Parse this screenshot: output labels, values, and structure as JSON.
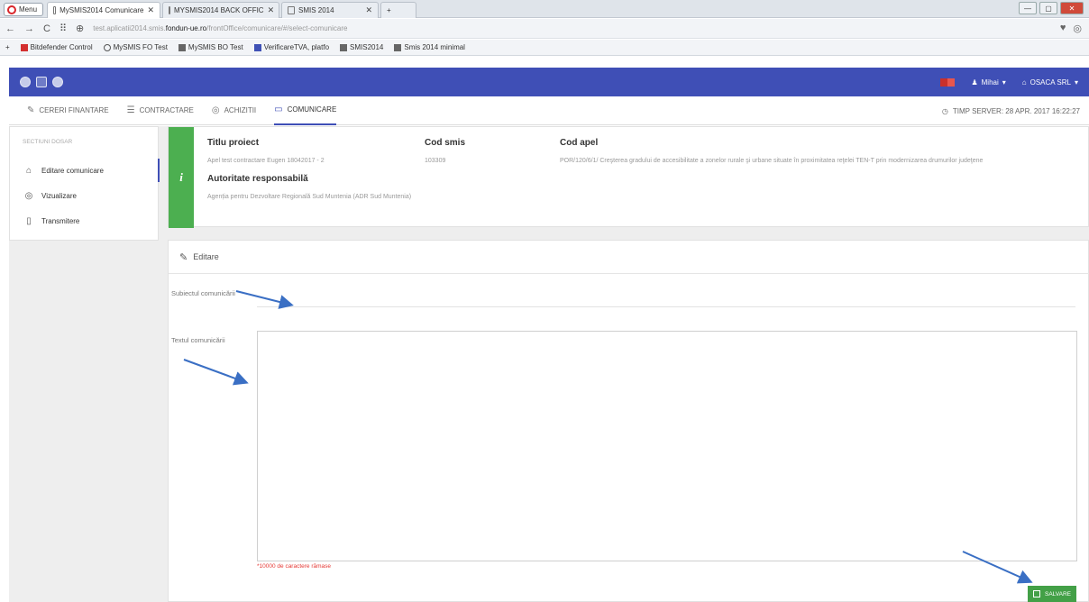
{
  "browser": {
    "menu_label": "Menu",
    "tabs": [
      {
        "label": "MySMIS2014 Comunicare"
      },
      {
        "label": "MYSMIS2014 BACK OFFIC"
      },
      {
        "label": "SMIS 2014"
      }
    ],
    "url_prefix": "test.aplicatii2014.smis.",
    "url_domain": "fondun-ue.ro",
    "url_suffix": "/frontOffice/comunicare/#/select-comunicare",
    "bookmarks": [
      {
        "label": "Bitdefender Control"
      },
      {
        "label": "MySMIS FO Test"
      },
      {
        "label": "MySMIS BO Test"
      },
      {
        "label": "VerificareTVA, platfo"
      },
      {
        "label": "SMIS2014"
      },
      {
        "label": "Smis 2014 minimal"
      }
    ]
  },
  "app": {
    "user": "Mihai",
    "organization": "OSACA SRL",
    "nav": [
      {
        "label": "CERERI FINANTARE",
        "icon": "pencil-icon"
      },
      {
        "label": "CONTRACTARE",
        "icon": "document-icon"
      },
      {
        "label": "ACHIZITII",
        "icon": "stack-icon"
      },
      {
        "label": "COMUNICARE",
        "icon": "chat-icon"
      }
    ],
    "server_time": "TIMP SERVER: 28 APR. 2017 16:22:27"
  },
  "sidebar": {
    "title": "SECTIUNI DOSAR",
    "items": [
      {
        "label": "Editare comunicare",
        "icon": "home-icon"
      },
      {
        "label": "Vizualizare",
        "icon": "stack-icon"
      },
      {
        "label": "Transmitere",
        "icon": "send-icon"
      }
    ]
  },
  "project": {
    "titlu_label": "Titlu proiect",
    "titlu_value": "Apel test contractare Eugen 18042017 - 2",
    "smis_label": "Cod smis",
    "smis_value": "103309",
    "apel_label": "Cod apel",
    "apel_value": "POR/120/6/1/ Creşterea gradului de accesibilitate a zonelor rurale şi urbane situate în proximitatea reţelei TEN-T prin modernizarea drumurilor judeţene",
    "autoritate_label": "Autoritate responsabilă",
    "autoritate_value": "Agenția pentru Dezvoltare Regională Sud Muntenia (ADR Sud Muntenia)"
  },
  "edit": {
    "header": "Editare",
    "subject_label": "Subiectul comunicării",
    "text_label": "Textul comunicării",
    "chars_left": "*10000 de caractere rămase",
    "save_label": "SALVARE"
  },
  "colors": {
    "primary": "#3f4fb6",
    "info_green": "#4caf50",
    "save_green": "#43a047",
    "arrow": "#3a6fc4"
  }
}
